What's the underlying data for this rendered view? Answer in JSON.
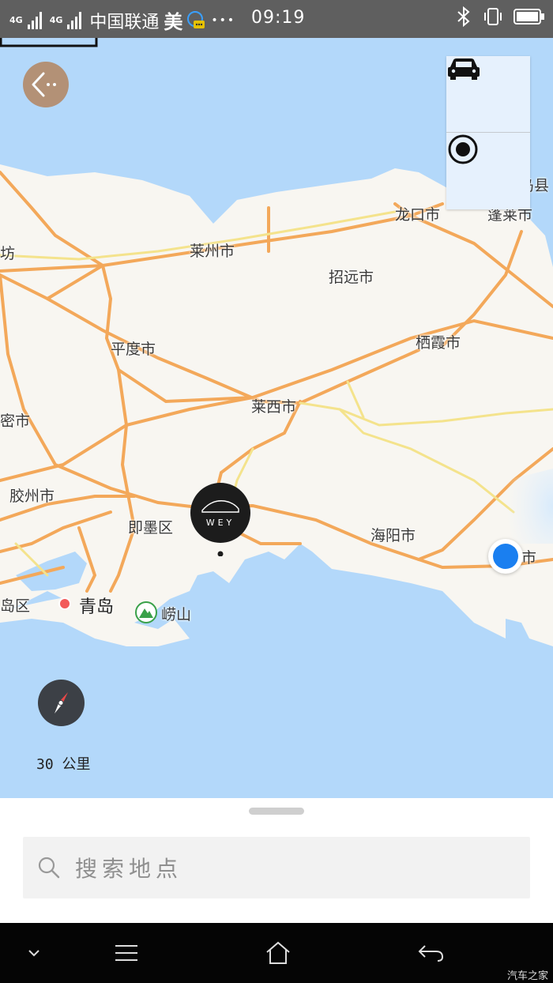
{
  "status_bar": {
    "network_a": "4G",
    "network_b": "4G",
    "carrier": "中国联通",
    "app_glyph": "美",
    "more": "•••",
    "time": "09:19",
    "icons": [
      "signal-icon",
      "message-icon",
      "bluetooth-icon",
      "vibrate-icon",
      "battery-icon"
    ]
  },
  "map": {
    "labels": {
      "changdao": "长岛县",
      "longkou": "龙口市",
      "penglai": "蓬莱市",
      "fang": "坊",
      "laizhou": "莱州市",
      "zhaoyuan": "招远市",
      "pingdu": "平度市",
      "qixia": "栖霞市",
      "laixi": "莱西市",
      "mi": "密市",
      "jiaozhou": "胶州市",
      "jimo": "即墨区",
      "haiyang": "海阳市",
      "shi_right": "市",
      "qingdao": "青岛",
      "laoshan": "崂山",
      "dao_qu": "岛区"
    },
    "pin_text": "WEY",
    "scale_label": "30 公里",
    "colors": {
      "water": "#b3d8fa",
      "land": "#f8f6f1",
      "road_major": "#f3a85a",
      "road_minor": "#f4e38c",
      "location": "#1a7ff0"
    }
  },
  "controls": {
    "back": "back-arrow-icon",
    "vehicle": "car-icon",
    "locate": "locate-icon",
    "compass": "compass-icon"
  },
  "search": {
    "placeholder": "搜索地点"
  },
  "nav_bar": {
    "items": [
      "chevron-down-icon",
      "menu-icon",
      "home-icon",
      "back-icon"
    ]
  },
  "watermark": "汽车之家"
}
